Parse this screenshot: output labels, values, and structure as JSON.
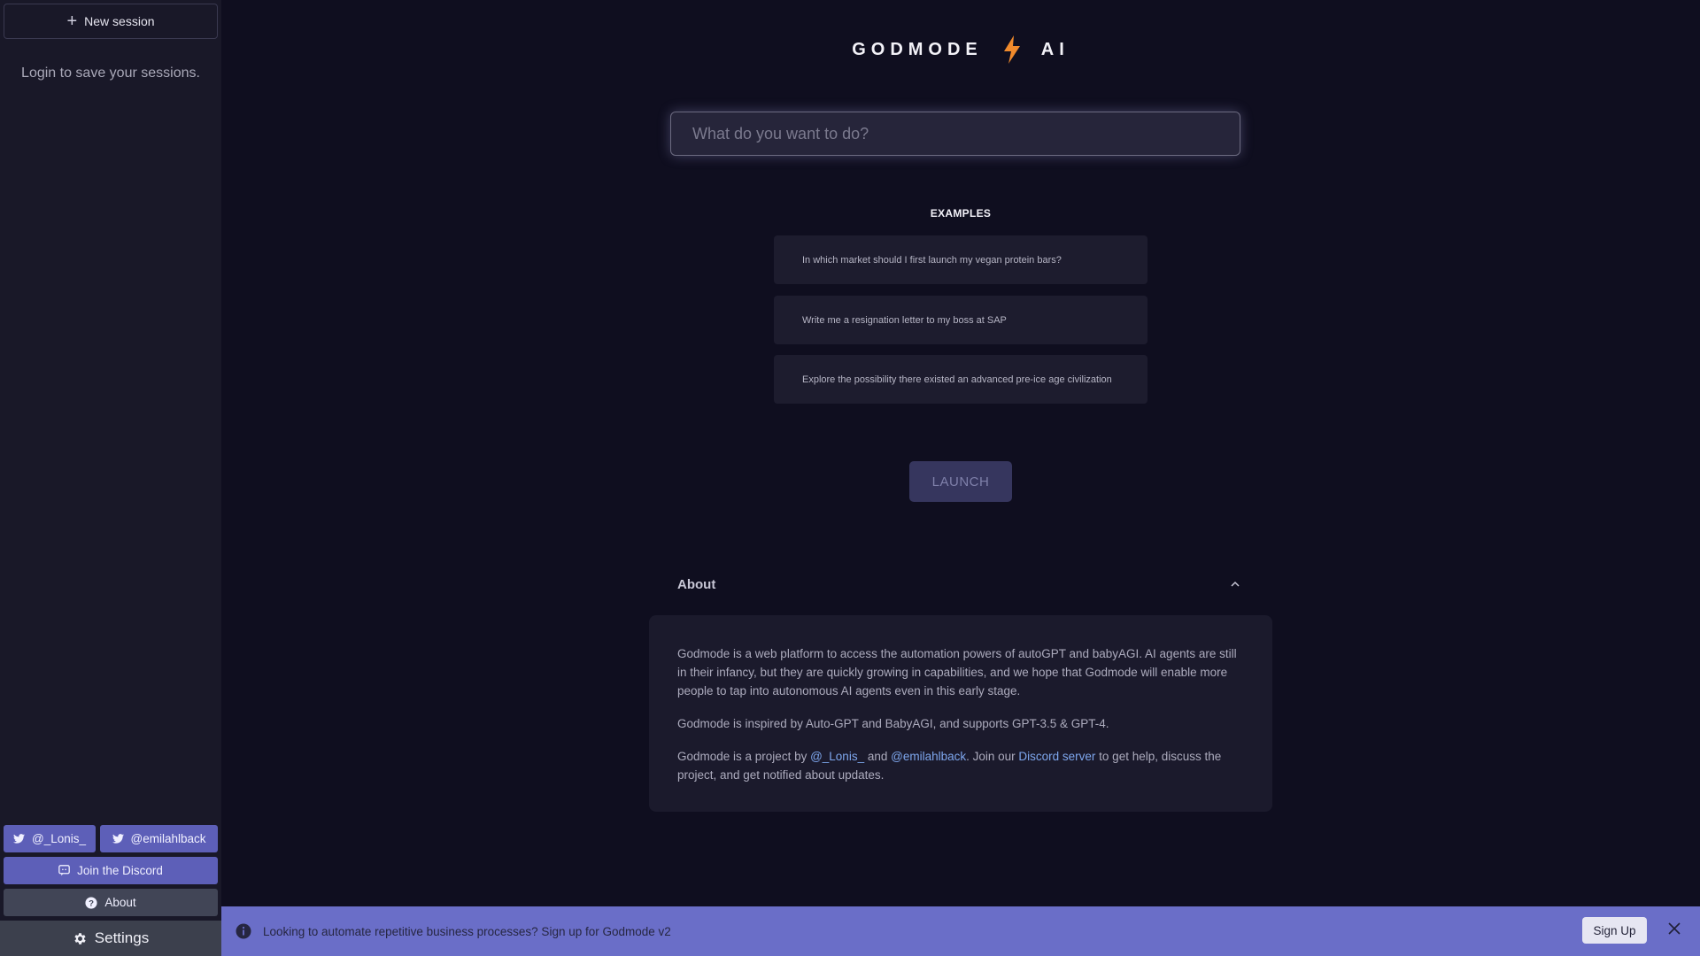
{
  "sidebar": {
    "new_session_label": "New session",
    "login_note": "Login to save your sessions.",
    "twitter_1": "@_Lonis_",
    "twitter_2": "@emilahlback",
    "discord_label": "Join the Discord",
    "about_label": "About",
    "settings_label": "Settings"
  },
  "header": {
    "brand_left": "GODMODE",
    "brand_right": "AI"
  },
  "search": {
    "placeholder": "What do you want to do?"
  },
  "examples": {
    "title": "EXAMPLES",
    "items": [
      "In which market should I first launch my vegan protein bars?",
      "Write me a resignation letter to my boss at SAP",
      "Explore the possibility there existed an advanced pre-ice age civilization"
    ]
  },
  "launch_label": "LAUNCH",
  "about": {
    "title": "About",
    "p1": "Godmode is a web platform to access the automation powers of autoGPT and babyAGI. AI agents are still in their infancy, but they are quickly growing in capabilities, and we hope that Godmode will enable more people to tap into autonomous AI agents even in this early stage.",
    "p2": "Godmode is inspired by Auto-GPT and BabyAGI, and supports GPT-3.5 & GPT-4.",
    "p3_a": "Godmode is a project by ",
    "p3_link1": "@_Lonis_",
    "p3_b": " and ",
    "p3_link2": "@emilahlback",
    "p3_c": ". Join our ",
    "p3_link3": "Discord server",
    "p3_d": " to get help, discuss the project, and get notified about updates."
  },
  "banner": {
    "message": "Looking to automate repetitive business processes? Sign up for Godmode v2",
    "signup_label": "Sign Up"
  },
  "colors": {
    "background": "#0f0e1f",
    "sidebar": "#191828",
    "accent": "#5d5fb8",
    "bolt": "#f08a2c",
    "link": "#7ea7ee",
    "banner": "#6a6ec8"
  }
}
